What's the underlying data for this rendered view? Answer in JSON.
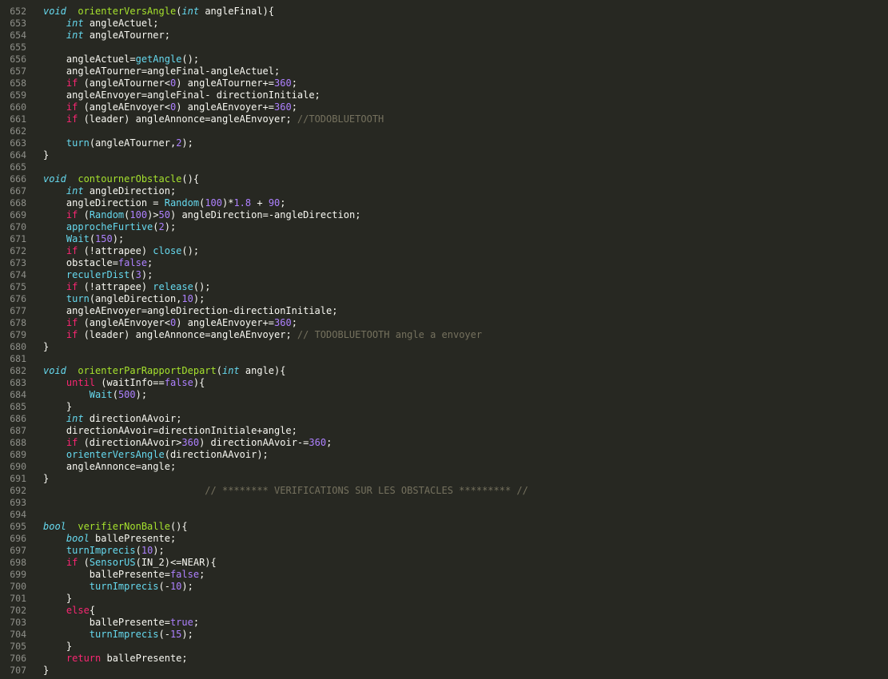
{
  "colors": {
    "background": "#272822",
    "text": "#f8f8f2",
    "line_number": "#8f908a",
    "keyword": "#f92672",
    "type": "#66d9ef",
    "function_def": "#a6e22e",
    "function_call": "#66d9ef",
    "number": "#ae81ff",
    "comment": "#75715e"
  },
  "lines": [
    {
      "n": "652",
      "t": [
        [
          "ty",
          "void"
        ],
        [
          "",
          "  "
        ],
        [
          "fn",
          "orienterVersAngle"
        ],
        [
          "",
          "("
        ],
        [
          "ty",
          "int"
        ],
        [
          "",
          " angleFinal){"
        ]
      ]
    },
    {
      "n": "653",
      "t": [
        [
          "",
          "    "
        ],
        [
          "ty",
          "int"
        ],
        [
          "",
          " angleActuel;"
        ]
      ]
    },
    {
      "n": "654",
      "t": [
        [
          "",
          "    "
        ],
        [
          "ty",
          "int"
        ],
        [
          "",
          " angleATourner;"
        ]
      ]
    },
    {
      "n": "655",
      "t": []
    },
    {
      "n": "656",
      "t": [
        [
          "",
          "    angleActuel="
        ],
        [
          "call",
          "getAngle"
        ],
        [
          "",
          "();"
        ]
      ]
    },
    {
      "n": "657",
      "t": [
        [
          "",
          "    angleATourner=angleFinal-angleActuel;"
        ]
      ]
    },
    {
      "n": "658",
      "t": [
        [
          "",
          "    "
        ],
        [
          "kw",
          "if"
        ],
        [
          "",
          " (angleATourner<"
        ],
        [
          "num",
          "0"
        ],
        [
          "",
          ") angleATourner+="
        ],
        [
          "num",
          "360"
        ],
        [
          "",
          ";"
        ]
      ]
    },
    {
      "n": "659",
      "t": [
        [
          "",
          "    angleAEnvoyer=angleFinal- directionInitiale;"
        ]
      ]
    },
    {
      "n": "660",
      "t": [
        [
          "",
          "    "
        ],
        [
          "kw",
          "if"
        ],
        [
          "",
          " (angleAEnvoyer<"
        ],
        [
          "num",
          "0"
        ],
        [
          "",
          ") angleAEnvoyer+="
        ],
        [
          "num",
          "360"
        ],
        [
          "",
          ";"
        ]
      ]
    },
    {
      "n": "661",
      "t": [
        [
          "",
          "    "
        ],
        [
          "kw",
          "if"
        ],
        [
          "",
          " (leader) angleAnnonce=angleAEnvoyer; "
        ],
        [
          "cm",
          "//TODOBLUETOOTH"
        ]
      ]
    },
    {
      "n": "662",
      "t": []
    },
    {
      "n": "663",
      "t": [
        [
          "",
          "    "
        ],
        [
          "call",
          "turn"
        ],
        [
          "",
          "(angleATourner,"
        ],
        [
          "num",
          "2"
        ],
        [
          "",
          ");"
        ]
      ]
    },
    {
      "n": "664",
      "t": [
        [
          "",
          "}"
        ]
      ]
    },
    {
      "n": "665",
      "t": []
    },
    {
      "n": "666",
      "t": [
        [
          "ty",
          "void"
        ],
        [
          "",
          "  "
        ],
        [
          "fn",
          "contournerObstacle"
        ],
        [
          "",
          "(){"
        ]
      ]
    },
    {
      "n": "667",
      "t": [
        [
          "",
          "    "
        ],
        [
          "ty",
          "int"
        ],
        [
          "",
          " angleDirection;"
        ]
      ]
    },
    {
      "n": "668",
      "t": [
        [
          "",
          "    angleDirection = "
        ],
        [
          "call",
          "Random"
        ],
        [
          "",
          "("
        ],
        [
          "num",
          "100"
        ],
        [
          "",
          ")*"
        ],
        [
          "num",
          "1.8"
        ],
        [
          "",
          " + "
        ],
        [
          "num",
          "90"
        ],
        [
          "",
          ";"
        ]
      ]
    },
    {
      "n": "669",
      "t": [
        [
          "",
          "    "
        ],
        [
          "kw",
          "if"
        ],
        [
          "",
          " ("
        ],
        [
          "call",
          "Random"
        ],
        [
          "",
          "("
        ],
        [
          "num",
          "100"
        ],
        [
          "",
          ")>"
        ],
        [
          "num",
          "50"
        ],
        [
          "",
          ") angleDirection=-angleDirection;"
        ]
      ]
    },
    {
      "n": "670",
      "t": [
        [
          "",
          "    "
        ],
        [
          "call",
          "approcheFurtive"
        ],
        [
          "",
          "("
        ],
        [
          "num",
          "2"
        ],
        [
          "",
          ");"
        ]
      ]
    },
    {
      "n": "671",
      "t": [
        [
          "",
          "    "
        ],
        [
          "call",
          "Wait"
        ],
        [
          "",
          "("
        ],
        [
          "num",
          "150"
        ],
        [
          "",
          ");"
        ]
      ]
    },
    {
      "n": "672",
      "t": [
        [
          "",
          "    "
        ],
        [
          "kw",
          "if"
        ],
        [
          "",
          " (!attrapee) "
        ],
        [
          "call",
          "close"
        ],
        [
          "",
          "();"
        ]
      ]
    },
    {
      "n": "673",
      "t": [
        [
          "",
          "    obstacle="
        ],
        [
          "num",
          "false"
        ],
        [
          "",
          ";"
        ]
      ]
    },
    {
      "n": "674",
      "t": [
        [
          "",
          "    "
        ],
        [
          "call",
          "reculerDist"
        ],
        [
          "",
          "("
        ],
        [
          "num",
          "3"
        ],
        [
          "",
          ");"
        ]
      ]
    },
    {
      "n": "675",
      "t": [
        [
          "",
          "    "
        ],
        [
          "kw",
          "if"
        ],
        [
          "",
          " (!attrapee) "
        ],
        [
          "call",
          "release"
        ],
        [
          "",
          "();"
        ]
      ]
    },
    {
      "n": "676",
      "t": [
        [
          "",
          "    "
        ],
        [
          "call",
          "turn"
        ],
        [
          "",
          "(angleDirection,"
        ],
        [
          "num",
          "10"
        ],
        [
          "",
          ");"
        ]
      ]
    },
    {
      "n": "677",
      "t": [
        [
          "",
          "    angleAEnvoyer=angleDirection-directionInitiale;"
        ]
      ]
    },
    {
      "n": "678",
      "t": [
        [
          "",
          "    "
        ],
        [
          "kw",
          "if"
        ],
        [
          "",
          " (angleAEnvoyer<"
        ],
        [
          "num",
          "0"
        ],
        [
          "",
          ") angleAEnvoyer+="
        ],
        [
          "num",
          "360"
        ],
        [
          "",
          ";"
        ]
      ]
    },
    {
      "n": "679",
      "t": [
        [
          "",
          "    "
        ],
        [
          "kw",
          "if"
        ],
        [
          "",
          " (leader) angleAnnonce=angleAEnvoyer; "
        ],
        [
          "cm",
          "// TODOBLUETOOTH angle a envoyer"
        ]
      ]
    },
    {
      "n": "680",
      "t": [
        [
          "",
          "}"
        ]
      ]
    },
    {
      "n": "681",
      "t": []
    },
    {
      "n": "682",
      "t": [
        [
          "ty",
          "void"
        ],
        [
          "",
          "  "
        ],
        [
          "fn",
          "orienterParRapportDepart"
        ],
        [
          "",
          "("
        ],
        [
          "ty",
          "int"
        ],
        [
          "",
          " angle){"
        ]
      ]
    },
    {
      "n": "683",
      "t": [
        [
          "",
          "    "
        ],
        [
          "kw",
          "until"
        ],
        [
          "",
          " (waitInfo=="
        ],
        [
          "num",
          "false"
        ],
        [
          "",
          "){"
        ]
      ]
    },
    {
      "n": "684",
      "t": [
        [
          "",
          "        "
        ],
        [
          "call",
          "Wait"
        ],
        [
          "",
          "("
        ],
        [
          "num",
          "500"
        ],
        [
          "",
          ");"
        ]
      ]
    },
    {
      "n": "685",
      "t": [
        [
          "",
          "    }"
        ]
      ]
    },
    {
      "n": "686",
      "t": [
        [
          "",
          "    "
        ],
        [
          "ty",
          "int"
        ],
        [
          "",
          " directionAAvoir;"
        ]
      ]
    },
    {
      "n": "687",
      "t": [
        [
          "",
          "    directionAAvoir=directionInitiale+angle;"
        ]
      ]
    },
    {
      "n": "688",
      "t": [
        [
          "",
          "    "
        ],
        [
          "kw",
          "if"
        ],
        [
          "",
          " (directionAAvoir>"
        ],
        [
          "num",
          "360"
        ],
        [
          "",
          ") directionAAvoir-="
        ],
        [
          "num",
          "360"
        ],
        [
          "",
          ";"
        ]
      ]
    },
    {
      "n": "689",
      "t": [
        [
          "",
          "    "
        ],
        [
          "call",
          "orienterVersAngle"
        ],
        [
          "",
          "(directionAAvoir);"
        ]
      ]
    },
    {
      "n": "690",
      "t": [
        [
          "",
          "    angleAnnonce=angle;"
        ]
      ]
    },
    {
      "n": "691",
      "t": [
        [
          "",
          "}"
        ]
      ]
    },
    {
      "n": "692",
      "t": [
        [
          "",
          "                            "
        ],
        [
          "cm",
          "// ******** VERIFICATIONS SUR LES OBSTACLES ********* //"
        ]
      ]
    },
    {
      "n": "693",
      "t": []
    },
    {
      "n": "694",
      "t": []
    },
    {
      "n": "695",
      "t": [
        [
          "ty",
          "bool"
        ],
        [
          "",
          "  "
        ],
        [
          "fn",
          "verifierNonBalle"
        ],
        [
          "",
          "(){"
        ]
      ]
    },
    {
      "n": "696",
      "t": [
        [
          "",
          "    "
        ],
        [
          "ty",
          "bool"
        ],
        [
          "",
          " ballePresente;"
        ]
      ]
    },
    {
      "n": "697",
      "t": [
        [
          "",
          "    "
        ],
        [
          "call",
          "turnImprecis"
        ],
        [
          "",
          "("
        ],
        [
          "num",
          "10"
        ],
        [
          "",
          ");"
        ]
      ]
    },
    {
      "n": "698",
      "t": [
        [
          "",
          "    "
        ],
        [
          "kw",
          "if"
        ],
        [
          "",
          " ("
        ],
        [
          "call",
          "SensorUS"
        ],
        [
          "",
          "(IN_2)<=NEAR){"
        ]
      ]
    },
    {
      "n": "699",
      "t": [
        [
          "",
          "        ballePresente="
        ],
        [
          "num",
          "false"
        ],
        [
          "",
          ";"
        ]
      ]
    },
    {
      "n": "700",
      "t": [
        [
          "",
          "        "
        ],
        [
          "call",
          "turnImprecis"
        ],
        [
          "",
          "(-"
        ],
        [
          "num",
          "10"
        ],
        [
          "",
          ");"
        ]
      ]
    },
    {
      "n": "701",
      "t": [
        [
          "",
          "    }"
        ]
      ]
    },
    {
      "n": "702",
      "t": [
        [
          "",
          "    "
        ],
        [
          "kw",
          "else"
        ],
        [
          "",
          "{"
        ]
      ]
    },
    {
      "n": "703",
      "t": [
        [
          "",
          "        ballePresente="
        ],
        [
          "num",
          "true"
        ],
        [
          "",
          ";"
        ]
      ]
    },
    {
      "n": "704",
      "t": [
        [
          "",
          "        "
        ],
        [
          "call",
          "turnImprecis"
        ],
        [
          "",
          "(-"
        ],
        [
          "num",
          "15"
        ],
        [
          "",
          ");"
        ]
      ]
    },
    {
      "n": "705",
      "t": [
        [
          "",
          "    }"
        ]
      ]
    },
    {
      "n": "706",
      "t": [
        [
          "",
          "    "
        ],
        [
          "kw",
          "return"
        ],
        [
          "",
          " ballePresente;"
        ]
      ]
    },
    {
      "n": "707",
      "t": [
        [
          "",
          "}"
        ]
      ]
    }
  ]
}
